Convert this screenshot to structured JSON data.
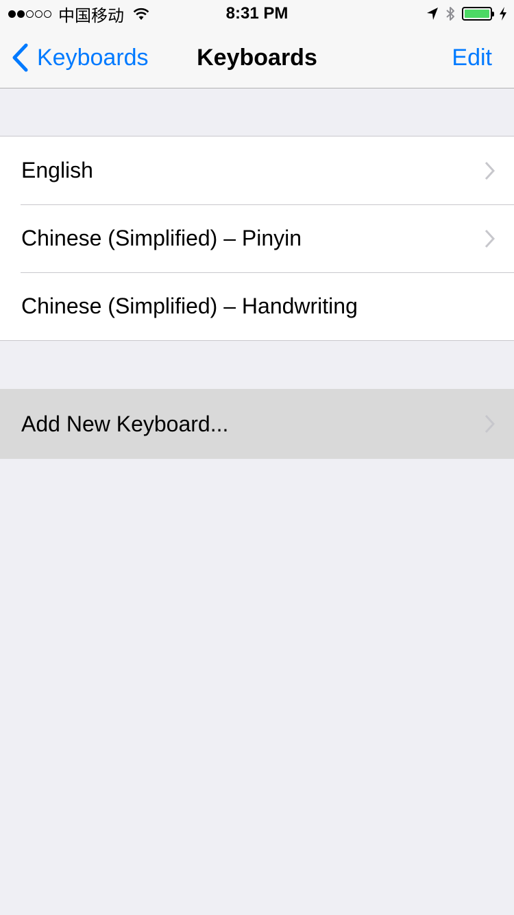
{
  "status_bar": {
    "carrier": "中国移动",
    "time": "8:31 PM",
    "signal_filled": 2,
    "signal_total": 5,
    "battery_level": 1.0,
    "battery_color": "#4cd964"
  },
  "nav": {
    "back_label": "Keyboards",
    "title": "Keyboards",
    "edit_label": "Edit",
    "accent_color": "#007aff"
  },
  "keyboards": {
    "items": [
      {
        "label": "English",
        "has_chevron": true
      },
      {
        "label": "Chinese (Simplified) – Pinyin",
        "has_chevron": true
      },
      {
        "label": "Chinese (Simplified) – Handwriting",
        "has_chevron": false
      }
    ]
  },
  "add_keyboard": {
    "label": "Add New Keyboard...",
    "has_chevron": true,
    "highlighted": true
  }
}
